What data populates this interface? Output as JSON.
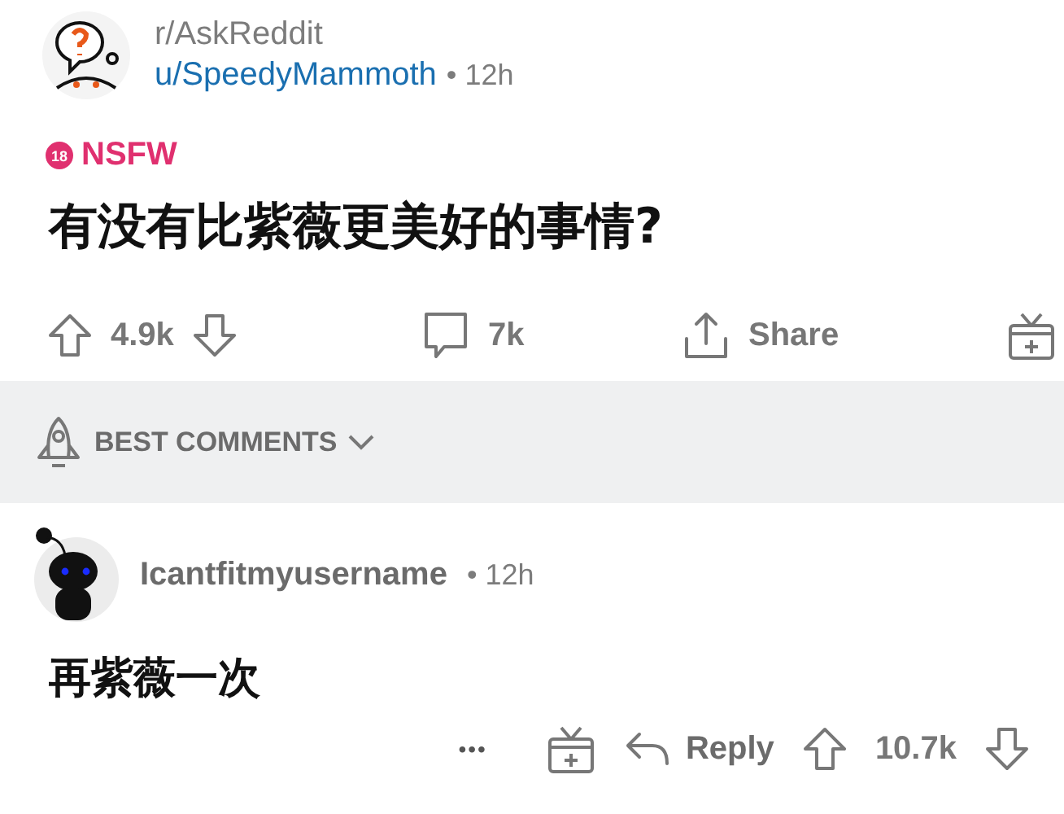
{
  "post": {
    "subreddit": "r/AskReddit",
    "author": "u/SpeedyMammoth",
    "time": "• 12h",
    "nsfw_badge": "18",
    "nsfw_label": "NSFW",
    "title": "有没有比紫薇更美好的事情?",
    "votes": "4.9k",
    "comments": "7k",
    "share": "Share"
  },
  "sort": {
    "label": "BEST COMMENTS"
  },
  "comment": {
    "author": "Icantfitmyusername",
    "time": "• 12h",
    "body": "再紫薇一次",
    "more": "•••",
    "reply": "Reply",
    "votes": "10.7k"
  }
}
